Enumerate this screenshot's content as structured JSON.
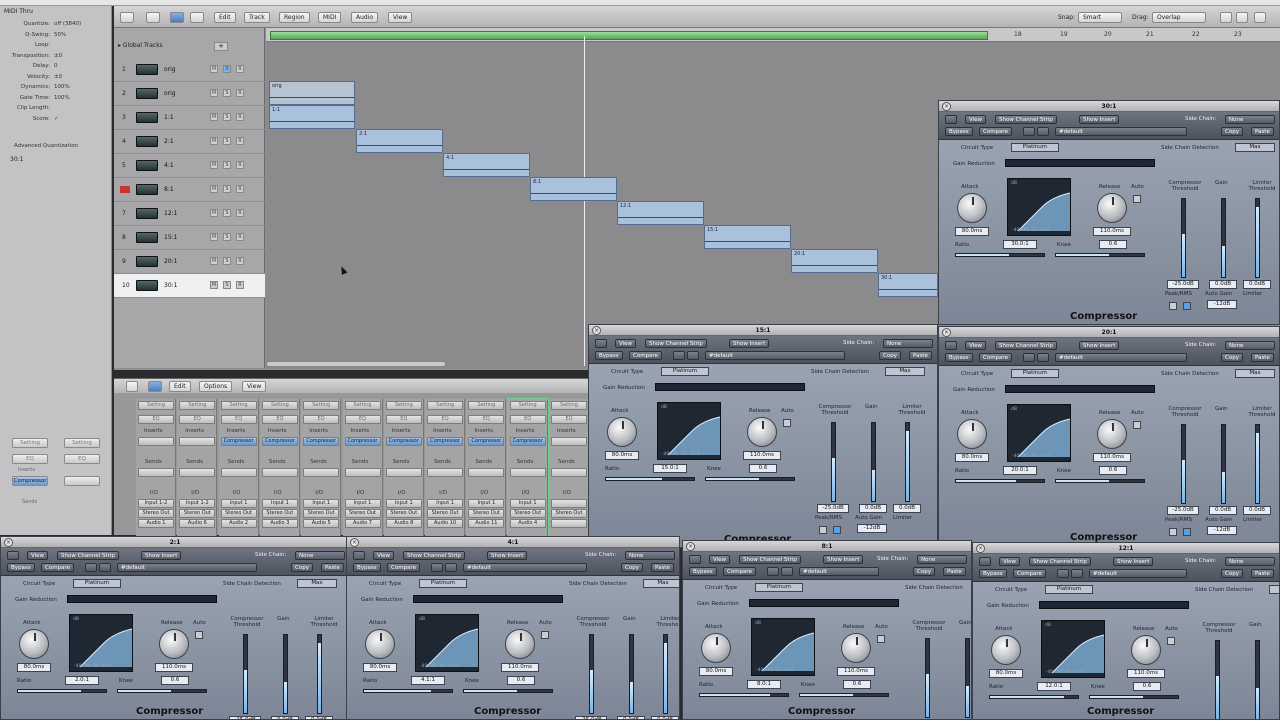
{
  "arrange": {
    "toolbar": {
      "edit": "Edit",
      "track": "Track",
      "region": "Region",
      "midi": "MIDI",
      "audio": "Audio",
      "view": "View",
      "snap_label": "Snap:",
      "snap_value": "Smart",
      "drag_label": "Drag:",
      "drag_value": "Overlap"
    },
    "global_tracks": "Global Tracks",
    "tracks": [
      {
        "num": "1",
        "name": "orig"
      },
      {
        "num": "2",
        "name": "orig"
      },
      {
        "num": "3",
        "name": "1:1"
      },
      {
        "num": "4",
        "name": "2:1"
      },
      {
        "num": "5",
        "name": "4:1"
      },
      {
        "num": "6",
        "name": "8:1"
      },
      {
        "num": "7",
        "name": "12:1"
      },
      {
        "num": "8",
        "name": "15:1"
      },
      {
        "num": "9",
        "name": "20:1"
      },
      {
        "num": "10",
        "name": "30:1"
      }
    ],
    "ruler": [
      "18",
      "19",
      "20",
      "21",
      "22",
      "23"
    ],
    "regions": [
      "orig",
      "1:1",
      "2:1",
      "4:1",
      "8:1",
      "12:1",
      "15:1",
      "20:1",
      "30:1"
    ]
  },
  "inspector": {
    "header": "MIDI Thru",
    "rows": [
      [
        "Quantize:",
        "off (3840)"
      ],
      [
        "Q-Swing:",
        "50%"
      ],
      [
        "Loop:",
        ""
      ],
      [
        "Transposition:",
        "±0"
      ],
      [
        "Delay:",
        "0"
      ],
      [
        "Velocity:",
        "±0"
      ],
      [
        "Dynamics:",
        "100%"
      ],
      [
        "Gate Time:",
        "100%"
      ],
      [
        "Clip Length:",
        ""
      ],
      [
        "Score:",
        "✓"
      ]
    ],
    "advanced": "Advanced Quantization",
    "region": "30:1",
    "setting": "Setting",
    "eq": "EQ",
    "inserts": "Inserts",
    "sends": "Sends",
    "compressor": "Compressor"
  },
  "mixer": {
    "toolbar": {
      "edit": "Edit",
      "options": "Options",
      "view": "View"
    },
    "strips": [
      {
        "insert": "",
        "io": "Input 1-2",
        "out": "Stereo Out",
        "name": "Audio 1"
      },
      {
        "insert": "",
        "io": "Input 1-2",
        "out": "Stereo Out",
        "name": "Audio 6"
      },
      {
        "insert": "Compressor",
        "io": "Input 1",
        "out": "Stereo Out",
        "name": "Audio 2"
      },
      {
        "insert": "Compressor",
        "io": "Input 1",
        "out": "Stereo Out",
        "name": "Audio 3"
      },
      {
        "insert": "Compressor",
        "io": "Input 1",
        "out": "Stereo Out",
        "name": "Audio 5"
      },
      {
        "insert": "Compressor",
        "io": "Input 1",
        "out": "Stereo Out",
        "name": "Audio 7"
      },
      {
        "insert": "Compressor",
        "io": "Input 1",
        "out": "Stereo Out",
        "name": "Audio 8"
      },
      {
        "insert": "Compressor",
        "io": "Input 1",
        "out": "Stereo Out",
        "name": "Audio 10"
      },
      {
        "insert": "Compressor",
        "io": "Input 1",
        "out": "Stereo Out",
        "name": "Audio 11"
      },
      {
        "insert": "Compressor",
        "io": "Input 1",
        "out": "Stereo Out",
        "name": "Audio 4"
      },
      {
        "insert": "",
        "io": "",
        "out": "Stereo Out",
        "name": ""
      }
    ],
    "labels": {
      "setting": "Setting",
      "eq": "EQ",
      "inserts": "Inserts",
      "sends": "Sends",
      "io": "I/O"
    }
  },
  "plugin_common": {
    "view": "View",
    "show_channel_strip": "Show Channel Strip",
    "show_insert": "Show Insert",
    "side_chain": "Side Chain:",
    "none": "None",
    "bypass": "Bypass",
    "compare": "Compare",
    "preset": "#default",
    "copy": "Copy",
    "paste": "Paste",
    "circuit_type": "Circuit Type",
    "platinum": "Platinum",
    "sc_detection": "Side Chain Detection",
    "max": "Max",
    "gain_reduction": "Gain Reduction",
    "attack": "Attack",
    "release": "Release",
    "auto": "Auto",
    "ratio": "Ratio",
    "knee": "Knee",
    "comp_threshold": "Compressor Threshold",
    "gain": "Gain",
    "limiter_threshold": "Limiter Threshold",
    "peak_rms": "Peak/RMS",
    "auto_gain": "Auto Gain",
    "limiter": "Limiter",
    "compressor": "Compressor",
    "graph_axis": "-40 -30 -20 -10 0",
    "db": "dB",
    "attack_val": "80.0ms",
    "release_val": "110.0ms",
    "knee_val": "0.6",
    "thr_val": "-25.0dB",
    "gain_val": "0.0dB",
    "lim_val": "0.0dB",
    "auto_gain_val": "-12dB"
  },
  "plugins": [
    {
      "title": "30:1",
      "ratio": "30.0:1"
    },
    {
      "title": "15:1",
      "ratio": "15.0:1"
    },
    {
      "title": "20:1",
      "ratio": "20.0:1"
    },
    {
      "title": "2:1",
      "ratio": "2.0:1"
    },
    {
      "title": "4:1",
      "ratio": "4.1:1"
    },
    {
      "title": "8:1",
      "ratio": "8.0:1"
    },
    {
      "title": "12:1",
      "ratio": "12.0:1"
    }
  ]
}
